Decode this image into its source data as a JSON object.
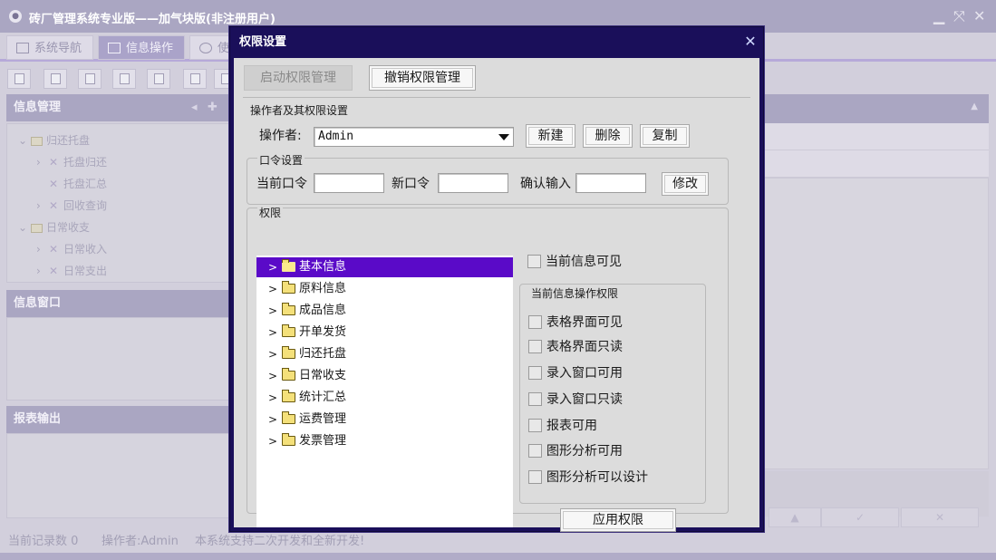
{
  "app": {
    "title": "砖厂管理系统专业版——加气块版(非注册用户)",
    "logo_icon": "app-logo-icon",
    "window_controls": [
      "minimize-icon",
      "restore-icon",
      "close-icon"
    ]
  },
  "tabs": [
    {
      "label": "系统导航",
      "icon": "monitor-icon"
    },
    {
      "label": "信息操作",
      "icon": "grid-icon"
    },
    {
      "label": "使",
      "icon": "clock-icon"
    }
  ],
  "left_panels": {
    "info_manage": {
      "title": "信息管理",
      "tree": [
        {
          "label": "归还托盘",
          "level": 0,
          "type": "folder"
        },
        {
          "label": "托盘归还",
          "level": 1,
          "type": "leaf"
        },
        {
          "label": "托盘汇总",
          "level": 1,
          "type": "leaf"
        },
        {
          "label": "回收查询",
          "level": 1,
          "type": "leaf"
        },
        {
          "label": "日常收支",
          "level": 0,
          "type": "folder"
        },
        {
          "label": "日常收入",
          "level": 1,
          "type": "leaf"
        },
        {
          "label": "日常支出",
          "level": 1,
          "type": "leaf"
        }
      ]
    },
    "info_window": {
      "title": "信息窗口"
    },
    "report_output": {
      "title": "报表输出"
    }
  },
  "statusbar": {
    "record_count": "当前记录数 0",
    "operator": "操作者:Admin",
    "notice": "本系统支持二次开发和全新开发!"
  },
  "dialog": {
    "title": "权限设置",
    "buttons": {
      "enable": "启动权限管理",
      "revoke": "撤销权限管理",
      "new": "新建",
      "delete": "删除",
      "copy": "复制",
      "modify": "修改",
      "apply": "应用权限"
    },
    "operator_group": {
      "title": "操作者及其权限设置",
      "label": "操作者:",
      "value": "Admin"
    },
    "password_group": {
      "title": "口令设置",
      "current_label": "当前口令",
      "new_label": "新口令",
      "confirm_label": "确认输入",
      "current_value": "",
      "new_value": "",
      "confirm_value": ""
    },
    "permission_group": {
      "title": "权限",
      "tree": [
        {
          "label": "基本信息",
          "selected": true
        },
        {
          "label": "原料信息",
          "selected": false
        },
        {
          "label": "成品信息",
          "selected": false
        },
        {
          "label": "开单发货",
          "selected": false
        },
        {
          "label": "归还托盘",
          "selected": false
        },
        {
          "label": "日常收支",
          "selected": false
        },
        {
          "label": "统计汇总",
          "selected": false
        },
        {
          "label": "运费管理",
          "selected": false
        },
        {
          "label": "发票管理",
          "selected": false
        }
      ],
      "current_visible": "当前信息可见",
      "op_group_title": "当前信息操作权限",
      "checks": [
        {
          "label": "表格界面可见",
          "checked": false
        },
        {
          "label": "表格界面只读",
          "checked": false
        },
        {
          "label": "录入窗口可用",
          "checked": false
        },
        {
          "label": "录入窗口只读",
          "checked": false
        },
        {
          "label": "报表可用",
          "checked": false
        },
        {
          "label": "图形分析可用",
          "checked": false
        },
        {
          "label": "图形分析可以设计",
          "checked": false
        }
      ]
    },
    "colors": {
      "frame": "#1a0f5a",
      "selection": "#5a0ac8",
      "body": "#dcdcdc"
    }
  }
}
